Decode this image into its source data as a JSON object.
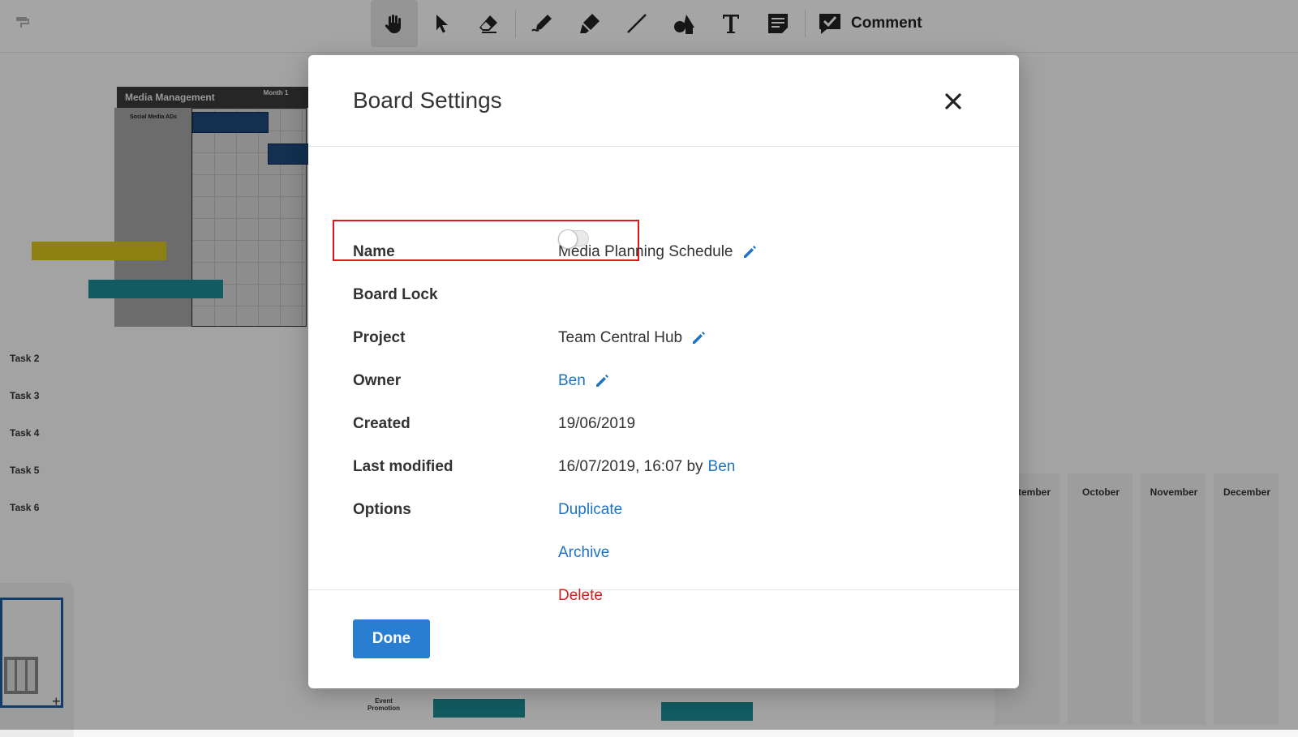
{
  "toolbar": {
    "comment_label": "Comment",
    "tools": [
      "hand-icon",
      "pointer-icon",
      "eraser-icon",
      "pen-icon",
      "highlighter-icon",
      "line-icon",
      "shapes-icon",
      "text-icon",
      "sticky-note-icon"
    ]
  },
  "board": {
    "header_title": "Media Management",
    "header_month": "Month 1",
    "social_label": "Social Media ADs",
    "tasks": [
      "Task 2",
      "Task 3",
      "Task 4",
      "Task 5",
      "Task 6"
    ],
    "months": [
      "tember",
      "October",
      "November",
      "December"
    ],
    "event_label": "Event Promotion",
    "plus": "+"
  },
  "modal": {
    "title": "Board Settings",
    "fields": {
      "name": {
        "label": "Name",
        "value": "Media Planning Schedule"
      },
      "board_lock": {
        "label": "Board Lock",
        "enabled": false
      },
      "project": {
        "label": "Project",
        "value": "Team Central Hub"
      },
      "owner": {
        "label": "Owner",
        "value": "Ben"
      },
      "created": {
        "label": "Created",
        "value": "19/06/2019"
      },
      "last_modified": {
        "label": "Last modified",
        "value": "16/07/2019, 16:07 by",
        "by": "Ben"
      },
      "options": {
        "label": "Options",
        "duplicate": "Duplicate",
        "archive": "Archive",
        "delete": "Delete"
      }
    },
    "done_label": "Done"
  },
  "colors": {
    "accent": "#2a7ed1",
    "link": "#1f72c4",
    "danger": "#d0201c",
    "highlight": "#e0181c"
  }
}
